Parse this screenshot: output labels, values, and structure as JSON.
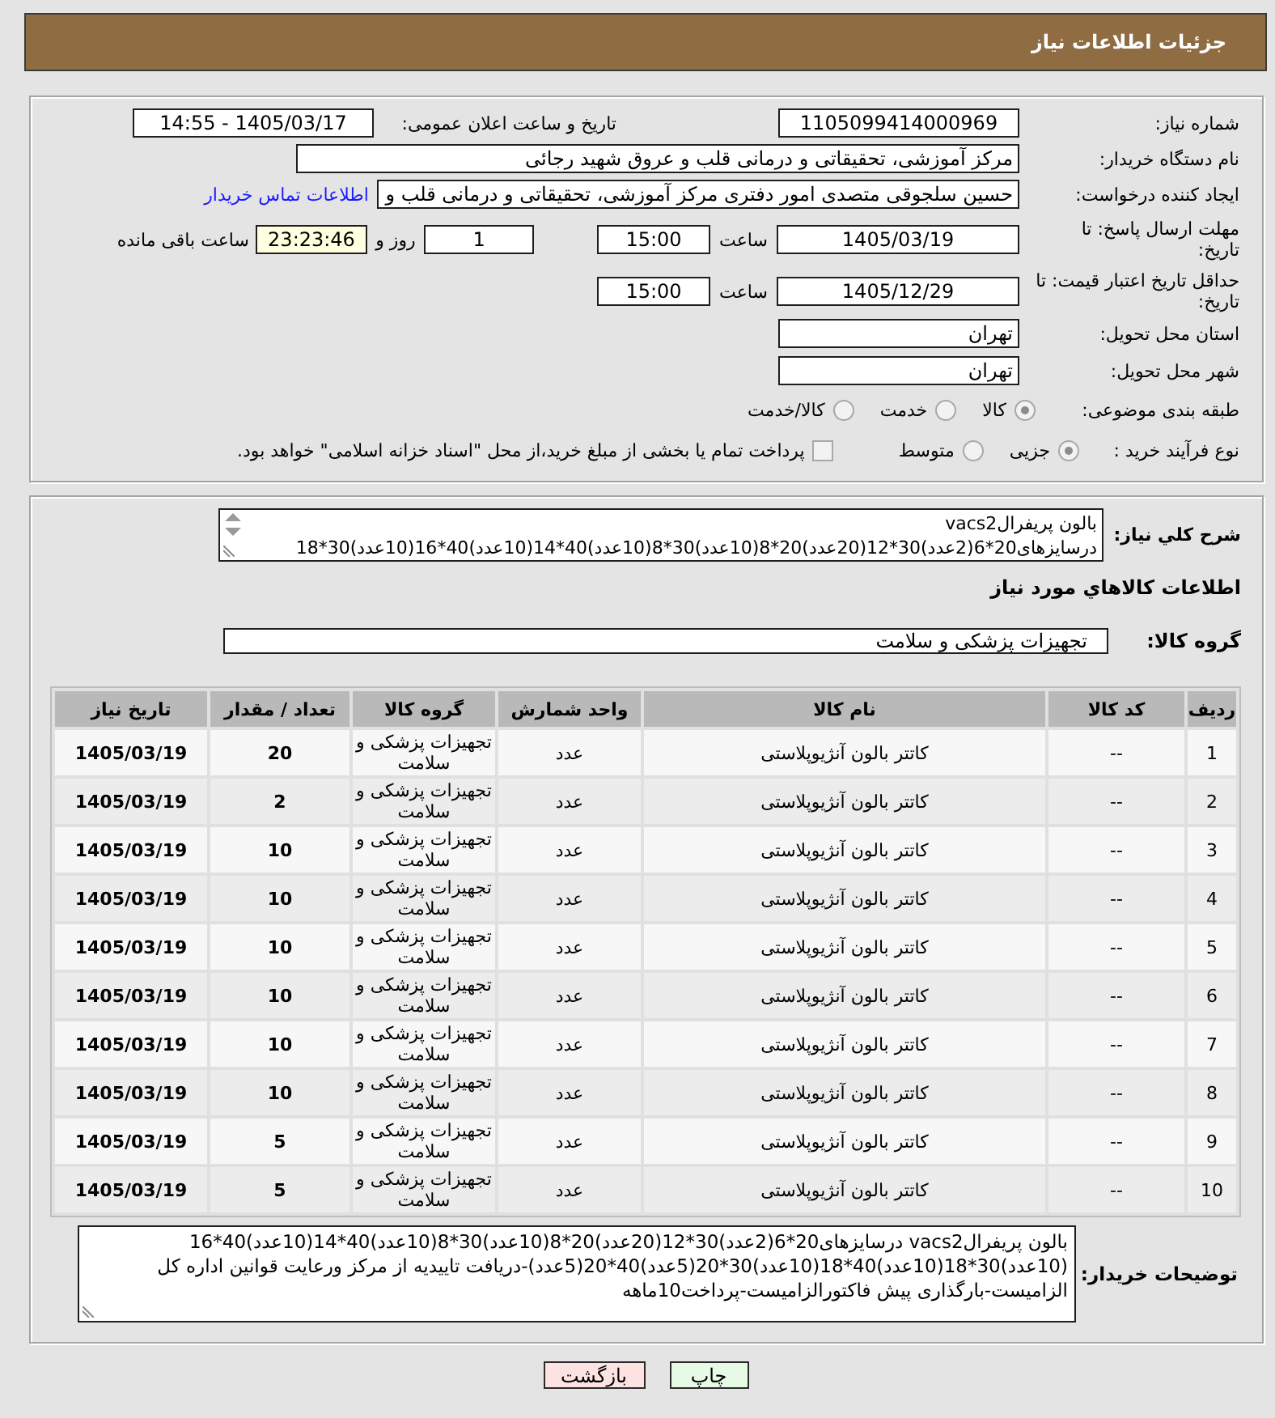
{
  "header": {
    "title": "جزئیات اطلاعات نیاز"
  },
  "details": {
    "need_number": {
      "label": "شماره نیاز:",
      "value": "1105099414000969"
    },
    "announcement": {
      "label": "تاریخ و ساعت اعلان عمومی:",
      "value": "1405/03/17 - 14:55"
    },
    "buyer_org": {
      "label": "نام دستگاه خریدار:",
      "value": "مرکز آموزشی، تحقیقاتی و درمانی قلب و عروق شهید رجائی"
    },
    "requester": {
      "label": "ایجاد کننده درخواست:",
      "value": "حسین سلجوقی متصدی امور دفتری مرکز آموزشی، تحقیقاتی و درمانی قلب و",
      "link": "اطلاعات تماس خریدار"
    },
    "response_deadline": {
      "label": "مهلت ارسال پاسخ: تا تاریخ:",
      "date": "1405/03/19",
      "time_label": "ساعت",
      "time": "15:00",
      "days": "1",
      "days_label": "روز و",
      "remaining": "23:23:46",
      "remaining_label": "ساعت باقی مانده"
    },
    "price_validity": {
      "label": "حداقل تاریخ اعتبار قیمت: تا تاریخ:",
      "date": "1405/12/29",
      "time_label": "ساعت",
      "time": "15:00"
    },
    "province": {
      "label": "استان محل تحویل:",
      "value": "تهران"
    },
    "city": {
      "label": "شهر محل تحویل:",
      "value": "تهران"
    },
    "category": {
      "label": "طبقه بندی موضوعی:",
      "options": [
        {
          "label": "کالا",
          "selected": true
        },
        {
          "label": "خدمت",
          "selected": false
        },
        {
          "label": "کالا/خدمت",
          "selected": false
        }
      ]
    },
    "purchase_type": {
      "label": "نوع فرآیند خرید :",
      "options": [
        {
          "label": "جزیی",
          "selected": true
        },
        {
          "label": "متوسط",
          "selected": false
        }
      ],
      "treasury": {
        "label": "پرداخت تمام یا بخشی از مبلغ خرید،از محل \"اسناد خزانه اسلامی\" خواهد بود.",
        "checked": false
      }
    }
  },
  "summary": {
    "label": "شرح کلي نياز:",
    "lines": [
      "بالون پریفرالvacs2",
      "درسایزهای20*6(2عدد)30*12(20عدد)20*8(10عدد)30*8(10عدد)40*14(10عدد)40*16(10عدد)30*18"
    ]
  },
  "goods": {
    "title": "اطلاعات کالاهاي مورد نياز",
    "group_label": "گروه کالا:",
    "group": "تجهیزات پزشکی و سلامت",
    "columns": [
      "ردیف",
      "کد کالا",
      "نام کالا",
      "واحد شمارش",
      "گروه کالا",
      "تعداد / مقدار",
      "تاریخ نیاز"
    ],
    "rows": [
      [
        "1",
        "--",
        "کاتتر بالون آنژیوپلاستی",
        "عدد",
        "تجهیزات پزشکی و سلامت",
        "20",
        "1405/03/19"
      ],
      [
        "2",
        "--",
        "کاتتر بالون آنژیوپلاستی",
        "عدد",
        "تجهیزات پزشکی و سلامت",
        "2",
        "1405/03/19"
      ],
      [
        "3",
        "--",
        "کاتتر بالون آنژیوپلاستی",
        "عدد",
        "تجهیزات پزشکی و سلامت",
        "10",
        "1405/03/19"
      ],
      [
        "4",
        "--",
        "کاتتر بالون آنژیوپلاستی",
        "عدد",
        "تجهیزات پزشکی و سلامت",
        "10",
        "1405/03/19"
      ],
      [
        "5",
        "--",
        "کاتتر بالون آنژیوپلاستی",
        "عدد",
        "تجهیزات پزشکی و سلامت",
        "10",
        "1405/03/19"
      ],
      [
        "6",
        "--",
        "کاتتر بالون آنژیوپلاستی",
        "عدد",
        "تجهیزات پزشکی و سلامت",
        "10",
        "1405/03/19"
      ],
      [
        "7",
        "--",
        "کاتتر بالون آنژیوپلاستی",
        "عدد",
        "تجهیزات پزشکی و سلامت",
        "10",
        "1405/03/19"
      ],
      [
        "8",
        "--",
        "کاتتر بالون آنژیوپلاستی",
        "عدد",
        "تجهیزات پزشکی و سلامت",
        "10",
        "1405/03/19"
      ],
      [
        "9",
        "--",
        "کاتتر بالون آنژیوپلاستی",
        "عدد",
        "تجهیزات پزشکی و سلامت",
        "5",
        "1405/03/19"
      ],
      [
        "10",
        "--",
        "کاتتر بالون آنژیوپلاستی",
        "عدد",
        "تجهیزات پزشکی و سلامت",
        "5",
        "1405/03/19"
      ]
    ]
  },
  "buyer_notes": {
    "label": "توضیحات خریدار:",
    "text": "بالون پریفرالvacs2 درسایزهای20*6(2عدد)30*12(20عدد)20*8(10عدد)30*8(10عدد)40*14(10عدد)40*16(10عدد)30*18(10عدد)40*18(10عدد)30*20(5عدد)40*20(5عدد)-دریافت تاییدیه از مرکز ورعایت قوانین اداره کل الزامیست-بارگذاری پیش فاکتورالزامیست-پرداخت10ماهه"
  },
  "buttons": [
    {
      "kind": "print",
      "label": "چاپ"
    },
    {
      "kind": "back",
      "label": "بازگشت"
    }
  ]
}
